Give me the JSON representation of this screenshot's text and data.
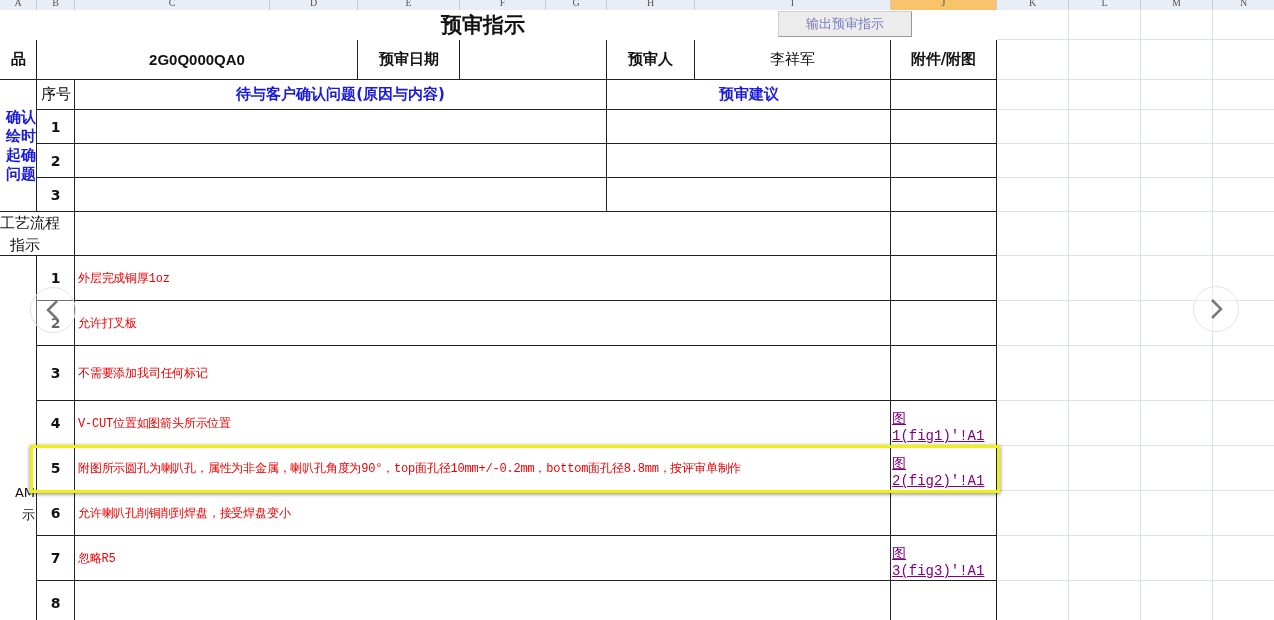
{
  "column_headers": [
    {
      "label": "A",
      "selected": false
    },
    {
      "label": "B",
      "selected": false
    },
    {
      "label": "C",
      "selected": false
    },
    {
      "label": "D",
      "selected": false
    },
    {
      "label": "E",
      "selected": false
    },
    {
      "label": "F",
      "selected": false
    },
    {
      "label": "G",
      "selected": false
    },
    {
      "label": "H",
      "selected": false
    },
    {
      "label": "I",
      "selected": false
    },
    {
      "label": "J",
      "selected": true
    },
    {
      "label": "K",
      "selected": false
    },
    {
      "label": "L",
      "selected": false
    },
    {
      "label": "M",
      "selected": false
    },
    {
      "label": "N",
      "selected": false
    }
  ],
  "title": "预审指示",
  "export_button": {
    "label": "输出预审指示",
    "disabled": true
  },
  "header": {
    "product_label": "品",
    "product_code": "2G0Q000QA0",
    "date_label": "预审日期",
    "reviewer_label": "预审人",
    "reviewer": "李祥军",
    "attachment_label": "附件/附图"
  },
  "confirm_section": {
    "label_lines": [
      "确认",
      "绘时",
      "起确",
      "问题"
    ],
    "index_heading": "序号",
    "issue_heading": "待与客户确认问题(原因与内容)",
    "advice_heading": "预审建议",
    "rows": [
      {
        "index": "1"
      },
      {
        "index": "2"
      },
      {
        "index": "3"
      }
    ]
  },
  "process_section": {
    "label_lines": [
      "工艺流程",
      "指示"
    ]
  },
  "cam_section": {
    "label_lines": [
      "AM",
      "示"
    ],
    "rows": [
      {
        "index": "1",
        "text": "外层完成铜厚1oz",
        "highlighted": false
      },
      {
        "index": "2",
        "text": "允许打叉板",
        "highlighted": false
      },
      {
        "index": "3",
        "text": "不需要添加我司任何标记",
        "highlighted": false
      },
      {
        "index": "4",
        "text": "V-CUT位置如图箭头所示位置",
        "attachment": "图\n1(fig1)'!A1",
        "highlighted": false
      },
      {
        "index": "5",
        "text": "附图所示圆孔为喇叭孔，属性为非金属，喇叭孔角度为90°，top面孔径10mm+/-0.2mm，bottom面孔径8.8mm，按评审单制作",
        "attachment": "图\n2(fig2)'!A1",
        "highlighted": true
      },
      {
        "index": "6",
        "text": "允许喇叭孔削铜削到焊盘，接受焊盘变小",
        "highlighted": false
      },
      {
        "index": "7",
        "text": "忽略R5",
        "attachment": "图\n3(fig3)'!A1",
        "highlighted": false
      },
      {
        "index": "8",
        "highlighted": false
      }
    ]
  }
}
